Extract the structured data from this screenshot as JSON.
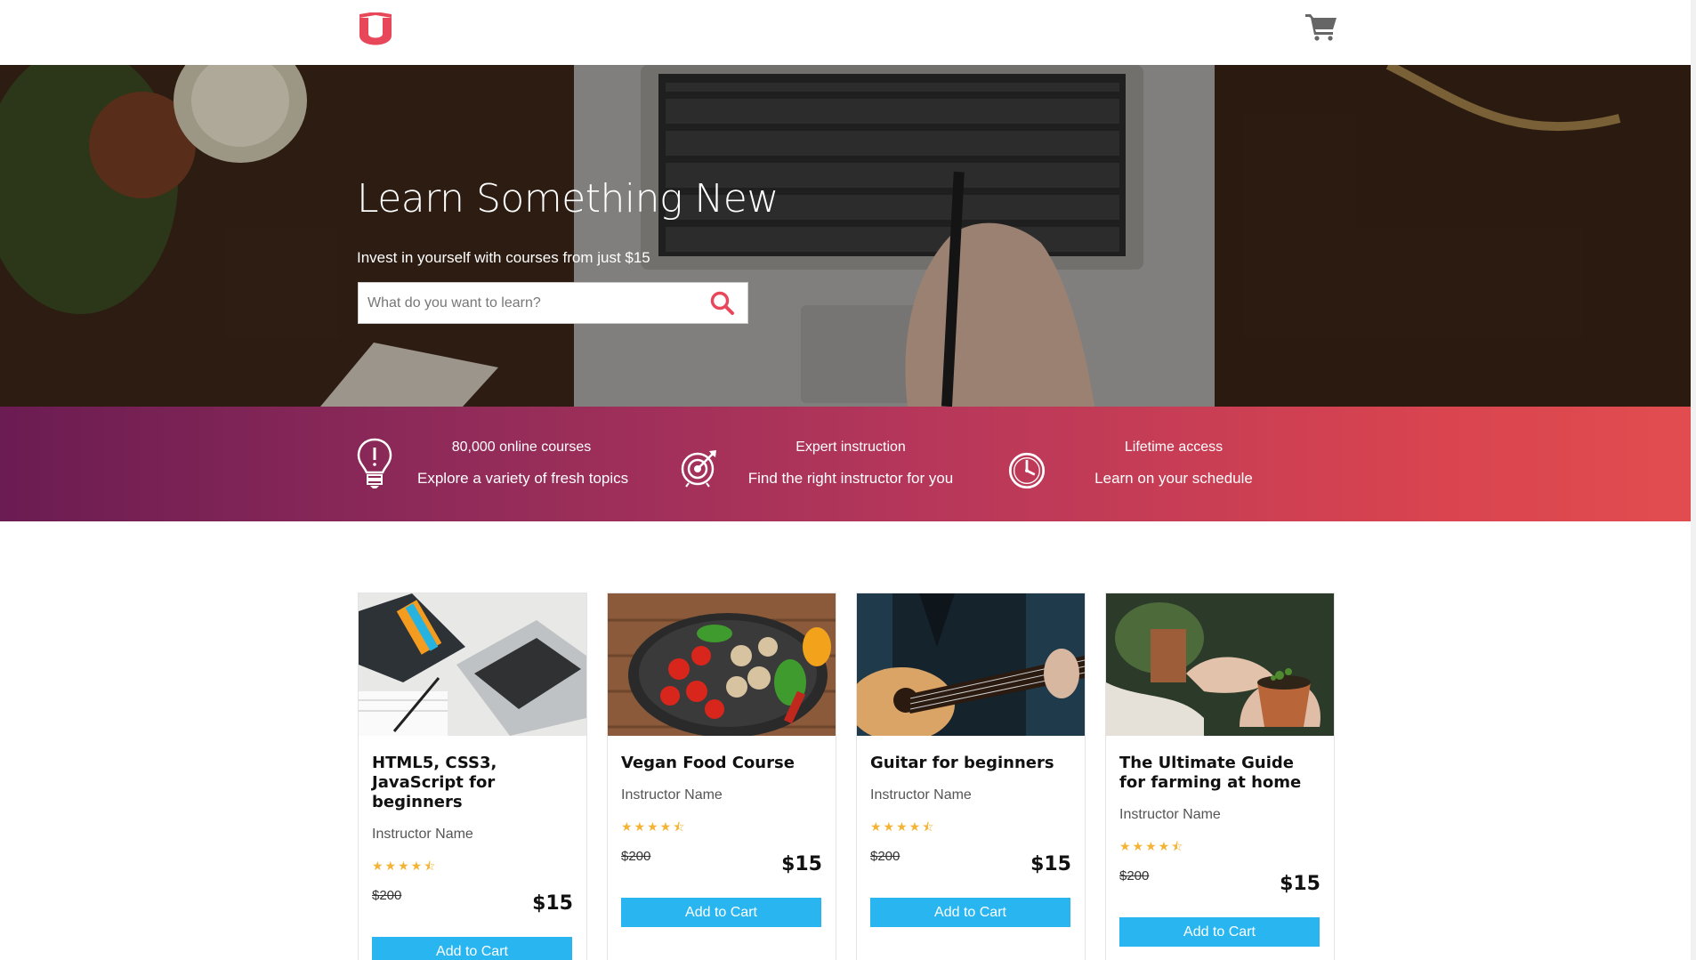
{
  "brand": {
    "logo_letter": "u",
    "accent": "#e8475a"
  },
  "navbar": {
    "cart_icon": "shopping-cart-icon"
  },
  "hero": {
    "title": "Learn Something New",
    "subtitle": "Invest in yourself with courses from just $15",
    "search": {
      "placeholder": "What do you want to learn?",
      "value": "",
      "icon": "search-icon"
    }
  },
  "features": [
    {
      "icon": "lightbulb-icon",
      "title": "80,000 online courses",
      "desc": "Explore a variety of fresh topics"
    },
    {
      "icon": "target-icon",
      "title": "Expert instruction",
      "desc": "Find the right instructor for you"
    },
    {
      "icon": "clock-icon",
      "title": "Lifetime access",
      "desc": "Learn on your schedule"
    }
  ],
  "courses": [
    {
      "title": "HTML5, CSS3, JavaScript for beginners",
      "instructor": "Instructor Name",
      "rating": 4.5,
      "stars": "★★★★⯪",
      "old_price": "$200",
      "price": "$15",
      "button": "Add to Cart"
    },
    {
      "title": "Vegan Food Course",
      "instructor": "Instructor Name",
      "rating": 4.5,
      "stars": "★★★★⯪",
      "old_price": "$200",
      "price": "$15",
      "button": "Add to Cart"
    },
    {
      "title": "Guitar for beginners",
      "instructor": "Instructor Name",
      "rating": 4.5,
      "stars": "★★★★⯪",
      "old_price": "$200",
      "price": "$15",
      "button": "Add to Cart"
    },
    {
      "title": "The Ultimate Guide for farming at home",
      "instructor": "Instructor Name",
      "rating": 4.5,
      "stars": "★★★★⯪",
      "old_price": "$200",
      "price": "$15",
      "button": "Add to Cart"
    }
  ],
  "colors": {
    "button": "#29b6f0",
    "stars": "#f4b334",
    "band_start": "#6b1c52",
    "band_end": "#e14d4f"
  }
}
